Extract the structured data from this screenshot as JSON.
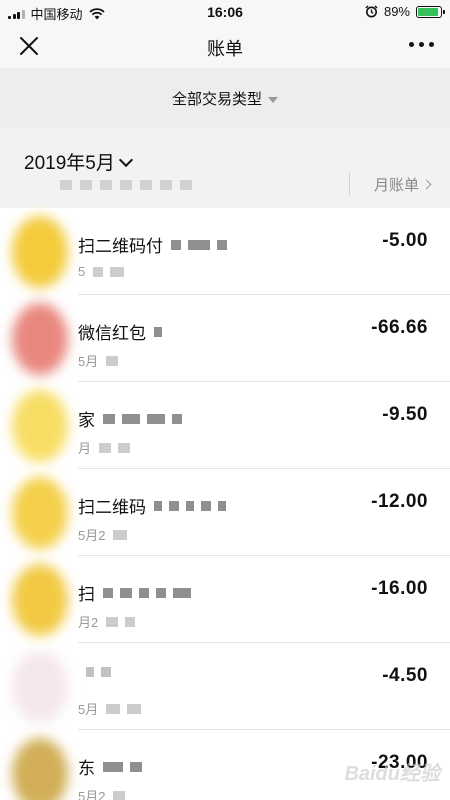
{
  "status_bar": {
    "carrier": "中国移动",
    "time": "16:06",
    "battery_percent": "89%",
    "battery_level": 0.89,
    "icons": [
      "signal-icon",
      "wifi-icon",
      "alarm-icon",
      "battery-icon"
    ]
  },
  "nav": {
    "title": "账单",
    "close_icon": "close-icon",
    "more_icon": "more-icon"
  },
  "filter": {
    "label": "全部交易类型"
  },
  "month": {
    "label": "2019年5月",
    "monthly_bill_link": "月账单"
  },
  "transactions": [
    {
      "title": "扫二维码付",
      "date": "5",
      "amount": "-5.00",
      "avatar_color": "#f2c21a"
    },
    {
      "title": "微信红包",
      "date": "5月",
      "amount": "-66.66",
      "avatar_color": "#e57368"
    },
    {
      "title": "家",
      "date": "月",
      "amount": "-9.50",
      "avatar_color": "#f6d84a"
    },
    {
      "title": "扫二维码",
      "date": "5月2",
      "amount": "-12.00",
      "avatar_color": "#f3c82c"
    },
    {
      "title": "扫",
      "date": "月2",
      "amount": "-16.00",
      "avatar_color": "#f0c023"
    },
    {
      "title": "",
      "date": "5月",
      "amount": "-4.50",
      "avatar_color": "#f3e3e6"
    },
    {
      "title": "东",
      "date": "5月2",
      "amount": "-23.00",
      "avatar_color": "#c9a13a"
    }
  ],
  "watermark": "Baidu经验"
}
